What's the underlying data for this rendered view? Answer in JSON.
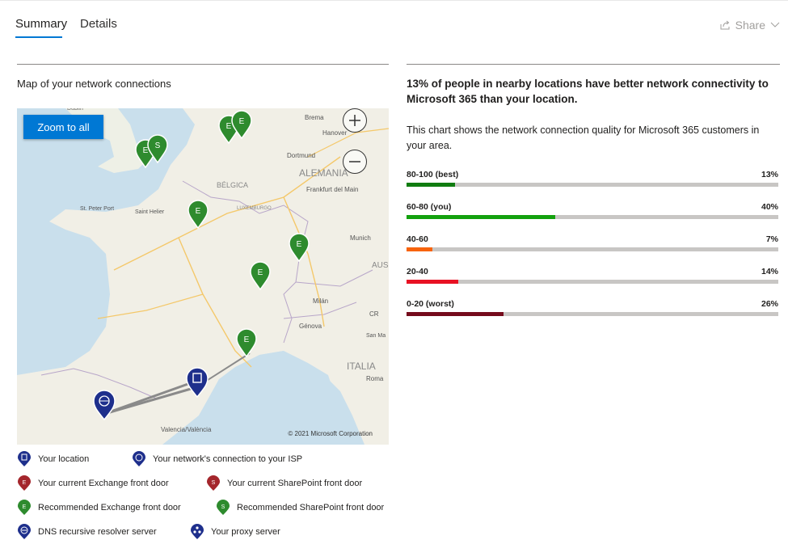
{
  "tabs": [
    {
      "label": "Summary"
    },
    {
      "label": "Details"
    }
  ],
  "share_label": "Share",
  "map": {
    "title": "Map of your network connections",
    "zoom_all_label": "Zoom to all",
    "copyright": "© 2021 Microsoft Corporation",
    "places": [
      "Dublin",
      "Brema",
      "Hanover",
      "Dortmund",
      "ALEMANIA",
      "BÉLGICA",
      "Frankfurt del Main",
      "LUXEMBURGO",
      "St. Peter Port",
      "Saint Helier",
      "Munich",
      "AUS",
      "Milán",
      "Génova",
      "San Ma",
      "CR",
      "ITALIA",
      "Roma",
      "Valencia/València"
    ]
  },
  "legend": [
    [
      {
        "label": "Your location",
        "icon": "building-pin-icon",
        "color": "#1e2f8c"
      },
      {
        "label": "Your network's connection to your ISP",
        "icon": "globe-pin-icon",
        "color": "#1e2f8c"
      }
    ],
    [
      {
        "label": "Your current Exchange front door",
        "icon": "exchange-pin-icon",
        "color": "#a4262c"
      },
      {
        "label": "Your current SharePoint front door",
        "icon": "sharepoint-pin-icon",
        "color": "#a4262c"
      }
    ],
    [
      {
        "label": "Recommended Exchange front door",
        "icon": "exchange-pin-icon",
        "color": "#2e8b2e"
      },
      {
        "label": "Recommended SharePoint front door",
        "icon": "sharepoint-pin-icon",
        "color": "#2e8b2e"
      }
    ],
    [
      {
        "label": "DNS recursive resolver server",
        "icon": "dns-pin-icon",
        "color": "#1e2f8c"
      },
      {
        "label": "Your proxy server",
        "icon": "proxy-pin-icon",
        "color": "#1e2f8c"
      }
    ]
  ],
  "summary": {
    "headline": "13% of people in nearby locations have better network connectivity to Microsoft 365 than your location.",
    "description": "This chart shows the network connection quality for Microsoft 365 customers in your area."
  },
  "quality_bars": [
    {
      "label": "80-100 (best)",
      "pct_text": "13%",
      "value": 0.13,
      "color": "#107c10"
    },
    {
      "label": "60-80 (you)",
      "pct_text": "40%",
      "value": 0.4,
      "color": "#13a10e"
    },
    {
      "label": "40-60",
      "pct_text": "7%",
      "value": 0.07,
      "color": "#f7630c"
    },
    {
      "label": "20-40",
      "pct_text": "14%",
      "value": 0.14,
      "color": "#e81123"
    },
    {
      "label": "0-20 (worst)",
      "pct_text": "26%",
      "value": 0.26,
      "color": "#750b1c"
    }
  ]
}
